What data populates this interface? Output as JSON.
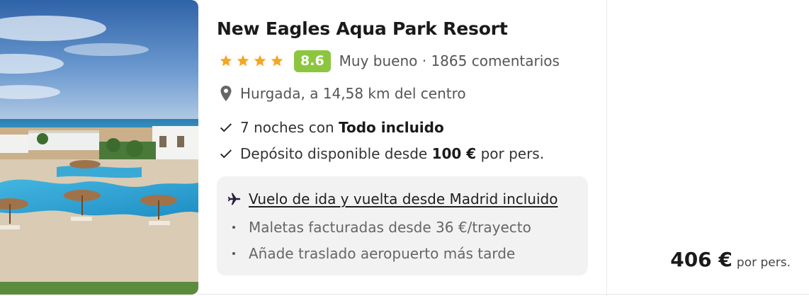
{
  "hotel": {
    "name": "New Eagles Aqua Park Resort",
    "stars": 4,
    "score": "8.6",
    "score_text": "Muy bueno · 1865 comentarios",
    "location": "Hurgada, a 14,58 km del centro",
    "features": [
      {
        "prefix": "7 noches con ",
        "bold": "Todo incluido",
        "suffix": ""
      },
      {
        "prefix": "Depósito disponible desde ",
        "bold": "100 €",
        "suffix": " por pers."
      }
    ],
    "flight": {
      "link_text": "Vuelo de ida y vuelta desde Madrid incluido",
      "details": [
        "Maletas facturadas desde 36 €/trayecto",
        "Añade traslado aeropuerto más tarde"
      ]
    }
  },
  "price": {
    "amount": "406 €",
    "per": "por pers."
  },
  "icons": {
    "star": "star-icon",
    "pin": "map-pin-icon",
    "check": "checkmark-icon",
    "plane": "airplane-icon"
  },
  "colors": {
    "star": "#f5a623",
    "score_bg": "#8cc63f",
    "flight_box_bg": "#f2f2f2"
  }
}
